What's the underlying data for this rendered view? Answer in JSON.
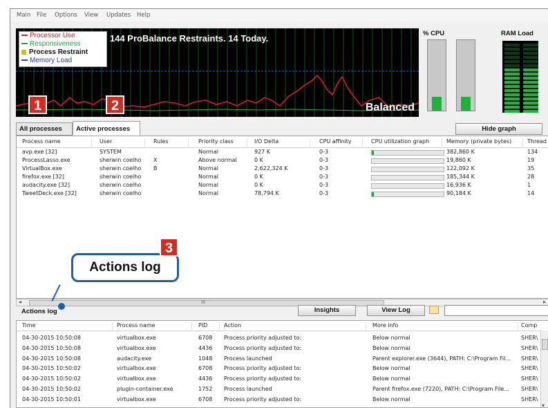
{
  "menu": [
    "Main",
    "File",
    "Options",
    "View",
    "Updates",
    "Help"
  ],
  "legend": [
    {
      "label": "Processor Use",
      "color": "#e0182a"
    },
    {
      "label": "Responsiveness",
      "color": "#17a83a"
    },
    {
      "label": "Process Restraint",
      "color": "#c9c20a"
    },
    {
      "label": "Memory Load",
      "color": "#1d3bc7"
    }
  ],
  "graph": {
    "headline": "144 ProBalance Restraints. 14 Today.",
    "status": "Balanced"
  },
  "badges": {
    "b1": "1",
    "b2": "2",
    "b3": "3"
  },
  "cpu_panel": {
    "title": "% CPU",
    "cores": [
      0.2,
      0.2
    ]
  },
  "ram_panel": {
    "title": "RAM Load"
  },
  "tabs": {
    "all": "All processes",
    "active": "Active processes"
  },
  "buttons": {
    "hide_graph": "Hide graph",
    "insights": "Insights",
    "view_log": "View Log"
  },
  "process_table": {
    "headers": [
      "Process name",
      "User",
      "Rules",
      "Priority class",
      "I/O Delta",
      "CPU affinity",
      "CPU utilization graph",
      "Memory (private bytes)",
      "Thread"
    ],
    "rows": [
      [
        "avp.exe [32]",
        "SYSTEM",
        "",
        "Normal",
        "927 K",
        "0-3",
        0.02,
        "382,860 K",
        "134"
      ],
      [
        "ProcessLasso.exe",
        "sherwin coelho",
        "X",
        "Above normal",
        "0 K",
        "0-3",
        0.0,
        "19,860 K",
        "19"
      ],
      [
        "VirtualBox.exe",
        "sherwin coelho",
        "B",
        "Normal",
        "2,622,324 K",
        "0-3",
        0.0,
        "122,092 K",
        "35"
      ],
      [
        "firefox.exe [32]",
        "sherwin coelho",
        "",
        "Normal",
        "0 K",
        "0-3",
        0.0,
        "185,344 K",
        "28"
      ],
      [
        "audacity.exe [32]",
        "sherwin coelho",
        "",
        "Normal",
        "0 K",
        "0-3",
        0.0,
        "16,936 K",
        "1"
      ],
      [
        "TweetDeck.exe [32]",
        "sherwin coelho",
        "",
        "Normal",
        "78,794 K",
        "0-3",
        0.02,
        "90,184 K",
        "14"
      ]
    ]
  },
  "scroll_label": "III",
  "actions_log": {
    "title": "Actions log",
    "callout": "Actions log",
    "headers": [
      "Time",
      "Process name",
      "PID",
      "Action",
      "More info",
      "Comp"
    ],
    "rows": [
      [
        "04-30-2015 10:50:08",
        "virtualbox.exe",
        "6708",
        "Process priority adjusted to:",
        "Below normal",
        "SHER\\"
      ],
      [
        "04-30-2015 10:50:08",
        "virtualbox.exe",
        "4436",
        "Process priority adjusted to:",
        "Below normal",
        "SHER\\"
      ],
      [
        "04-30-2015 10:50:08",
        "audacity.exe",
        "1048",
        "Process launched",
        "Parent explorer.exe (3644), PATH: C:\\Program Fil...",
        "SHER\\"
      ],
      [
        "04-30-2015 10:50:02",
        "virtualbox.exe",
        "6708",
        "Process priority adjusted to:",
        "Below normal",
        "SHER\\"
      ],
      [
        "04-30-2015 10:50:02",
        "virtualbox.exe",
        "4436",
        "Process priority adjusted to:",
        "Below normal",
        "SHER\\"
      ],
      [
        "04-30-2015 10:50:02",
        "plugin-container.exe",
        "1752",
        "Process launched",
        "Parent firefox.exe (7220), PATH: C:\\Program File...",
        "SHER\\"
      ],
      [
        "04-30-2015 10:50:01",
        "virtualbox.exe",
        "6708",
        "Process priority adjusted to:",
        "Below normal",
        "SHER\\"
      ]
    ]
  }
}
